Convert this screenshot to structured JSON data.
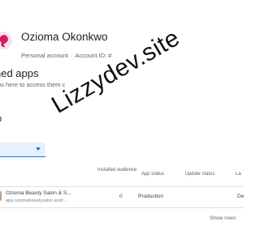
{
  "account": {
    "name": "Ozioma Okonkwo",
    "type_label": "Personal account",
    "id_label": "Account ID: #"
  },
  "pinned": {
    "title": "ned apps",
    "description": "ps here to access them c"
  },
  "section": {
    "title": "p",
    "filter_label": "y"
  },
  "table": {
    "headers": {
      "installed_audience": "Installed audience",
      "app_status": "App status",
      "update_status": "Update status",
      "last": "La"
    },
    "rows": [
      {
        "name": "Ozioma Beauty Salon & S...",
        "package": "app.oziomabeautysalon.andr...",
        "installed_audience": "0",
        "app_status": "Production",
        "last": "De"
      }
    ]
  },
  "footer": {
    "rows_label": "Show rows:"
  },
  "watermark": {
    "text": "Lizzydev.site"
  },
  "colors": {
    "accent": "#1a73e8",
    "dropdown_bg": "#e8f0fe",
    "avatar": "#d81b60"
  }
}
